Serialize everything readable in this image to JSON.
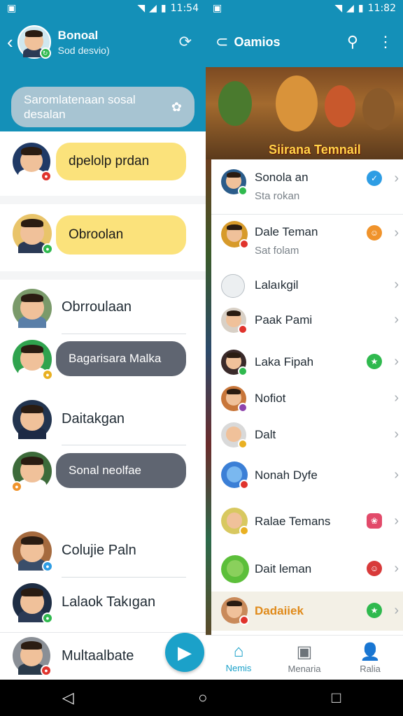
{
  "status_left": {
    "time": "11:54"
  },
  "status_right": {
    "time": "11:82"
  },
  "left": {
    "title": "Bonoal",
    "subtitle": "Sod desvio)",
    "search_text": "Saromlatenaan sosal desalan",
    "chats": [
      {
        "name": "dpelolp prdan",
        "style": "yellow-bubble"
      },
      {
        "name": "Obroolan",
        "style": "yellow-bubble"
      },
      {
        "name": "Obrroulaan",
        "style": "plain"
      },
      {
        "name": "Bagarisara Malka",
        "style": "gray-bubble"
      },
      {
        "name": "Daitakgan",
        "style": "plain"
      },
      {
        "name": "Sonal neolfae",
        "style": "gray-bubble"
      },
      {
        "name": "Colujie Paln",
        "style": "plain"
      },
      {
        "name": "Lalaok Takıgan",
        "style": "plain"
      },
      {
        "name": "Multaalbate",
        "style": "plain"
      }
    ]
  },
  "right": {
    "title": "Oamios",
    "banner_text": "Siirana Temnail",
    "items": [
      {
        "name": "Sonola an",
        "sub": "Sta rokan",
        "badge": "✓",
        "badge_color": "#2e9de4"
      },
      {
        "name": "Dale Teman",
        "sub": "Sat folam",
        "badge": "☺",
        "badge_color": "#f0932b"
      },
      {
        "name": "Lalaıkgil",
        "sub": "",
        "badge": "",
        "badge_color": ""
      },
      {
        "name": "Paak Pami",
        "sub": "",
        "badge": "",
        "badge_color": ""
      },
      {
        "name": "Laka Fipah",
        "sub": "",
        "badge": "★",
        "badge_color": "#2fb94e"
      },
      {
        "name": "Nofiot",
        "sub": "",
        "badge": "",
        "badge_color": ""
      },
      {
        "name": "Dalt",
        "sub": "",
        "badge": "",
        "badge_color": ""
      },
      {
        "name": "Nonah Dyfe",
        "sub": "",
        "badge": "",
        "badge_color": ""
      },
      {
        "name": "Ralae Temans",
        "sub": "",
        "badge": "",
        "badge_color": ""
      },
      {
        "name": "Dait leman",
        "sub": "",
        "badge": "",
        "badge_color": ""
      },
      {
        "name": "Dadaiiek",
        "sub": "",
        "badge": "★",
        "badge_color": "#2fb94e"
      }
    ],
    "tabs": [
      {
        "label": "Nemis",
        "icon": "home-icon",
        "active": true
      },
      {
        "label": "Menaria",
        "icon": "gallery-icon",
        "active": false
      },
      {
        "label": "Ralia",
        "icon": "person-icon",
        "active": false
      }
    ]
  },
  "colors": {
    "primary": "#1490b8",
    "accent": "#1ba1c9",
    "bubble_yellow": "#fbe27b",
    "bubble_gray": "#5f6571"
  }
}
